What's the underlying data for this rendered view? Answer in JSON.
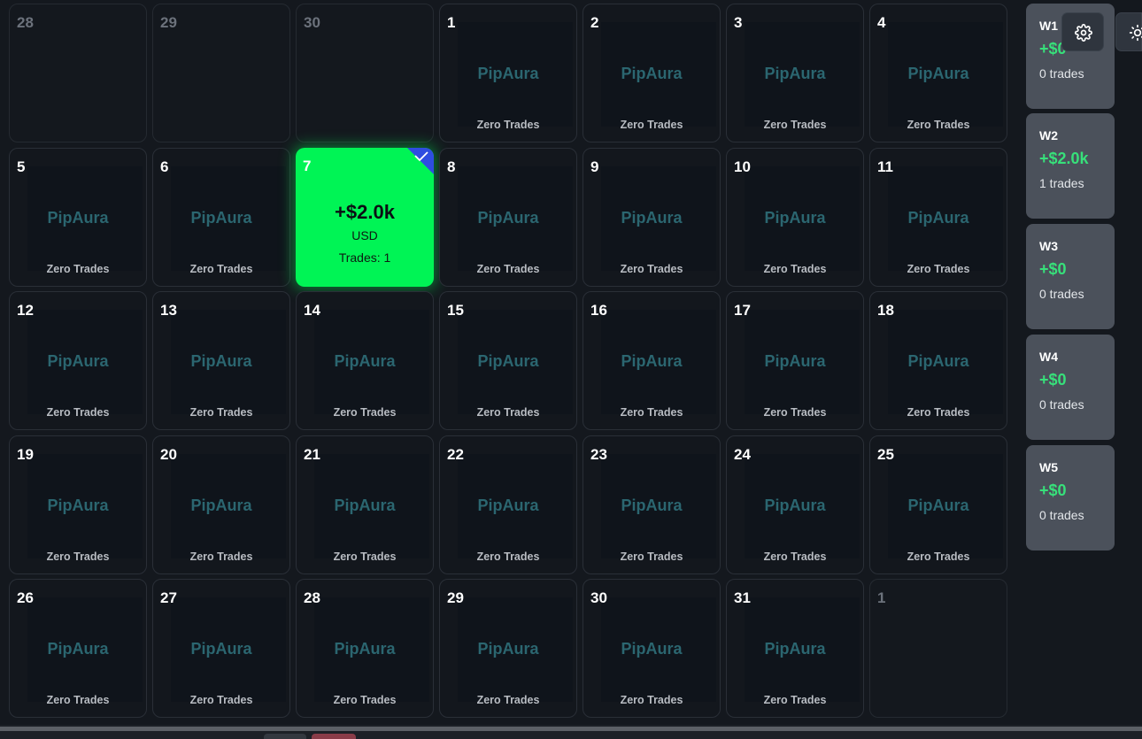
{
  "calendar": {
    "brand_text": "PipAura",
    "zero_text": "Zero Trades",
    "cells": [
      {
        "day": "28",
        "type": "out"
      },
      {
        "day": "29",
        "type": "out"
      },
      {
        "day": "30",
        "type": "out"
      },
      {
        "day": "1",
        "type": "empty"
      },
      {
        "day": "2",
        "type": "empty"
      },
      {
        "day": "3",
        "type": "empty"
      },
      {
        "day": "4",
        "type": "empty"
      },
      {
        "day": "5",
        "type": "empty"
      },
      {
        "day": "6",
        "type": "empty"
      },
      {
        "day": "7",
        "type": "active",
        "pnl": "+$2.0k",
        "currency": "USD",
        "trades": "Trades: 1",
        "checked": true
      },
      {
        "day": "8",
        "type": "empty"
      },
      {
        "day": "9",
        "type": "empty"
      },
      {
        "day": "10",
        "type": "empty"
      },
      {
        "day": "11",
        "type": "empty"
      },
      {
        "day": "12",
        "type": "empty"
      },
      {
        "day": "13",
        "type": "empty"
      },
      {
        "day": "14",
        "type": "empty"
      },
      {
        "day": "15",
        "type": "empty"
      },
      {
        "day": "16",
        "type": "empty"
      },
      {
        "day": "17",
        "type": "empty"
      },
      {
        "day": "18",
        "type": "empty"
      },
      {
        "day": "19",
        "type": "empty"
      },
      {
        "day": "20",
        "type": "empty"
      },
      {
        "day": "21",
        "type": "empty"
      },
      {
        "day": "22",
        "type": "empty"
      },
      {
        "day": "23",
        "type": "empty"
      },
      {
        "day": "24",
        "type": "empty"
      },
      {
        "day": "25",
        "type": "empty"
      },
      {
        "day": "26",
        "type": "empty"
      },
      {
        "day": "27",
        "type": "empty"
      },
      {
        "day": "28",
        "type": "empty"
      },
      {
        "day": "29",
        "type": "empty"
      },
      {
        "day": "30",
        "type": "empty"
      },
      {
        "day": "31",
        "type": "empty"
      },
      {
        "day": "1",
        "type": "out"
      }
    ]
  },
  "weeks": [
    {
      "label": "W1",
      "pnl": "+$0",
      "trades": "0 trades"
    },
    {
      "label": "W2",
      "pnl": "+$2.0k",
      "trades": "1 trades"
    },
    {
      "label": "W3",
      "pnl": "+$0",
      "trades": "0 trades"
    },
    {
      "label": "W4",
      "pnl": "+$0",
      "trades": "0 trades"
    },
    {
      "label": "W5",
      "pnl": "+$0",
      "trades": "0 trades"
    }
  ],
  "toolbar": {
    "settings_icon": "gear-icon",
    "theme_icon": "sun-icon"
  },
  "colors": {
    "background": "#14181e",
    "active_day": "#00f455",
    "positive": "#37e07a",
    "brand": "#2b6670",
    "check_corner": "#2f4de0"
  }
}
